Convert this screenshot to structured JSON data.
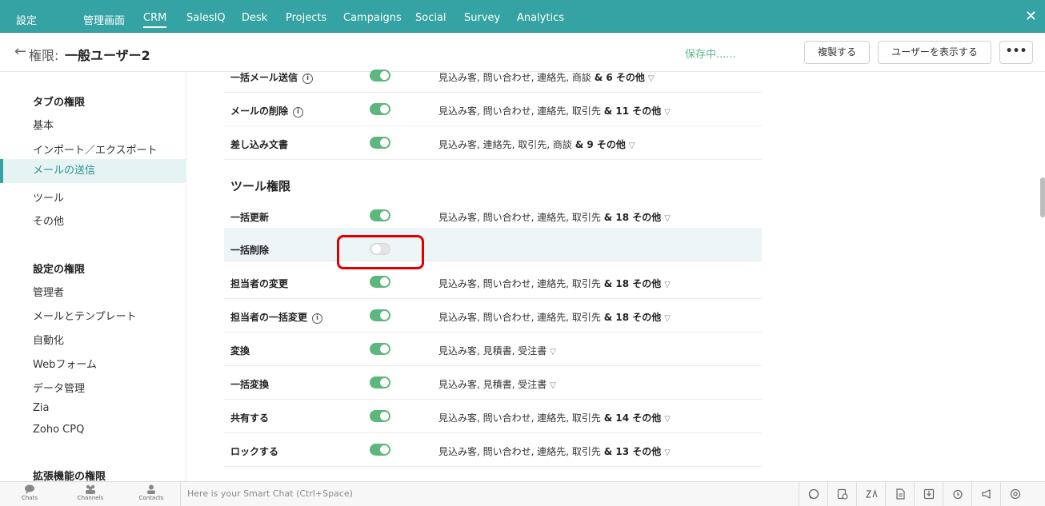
{
  "topbar": {
    "app_label": "設定",
    "nav": [
      "管理画面",
      "CRM",
      "SalesIQ",
      "Desk",
      "Projects",
      "Campaigns",
      "Social",
      "Survey",
      "Analytics"
    ],
    "active_nav": "CRM",
    "close_symbol": "✕"
  },
  "header": {
    "back_symbol": "←",
    "title_prefix": "権限:",
    "title_name": "一般ユーザー2",
    "saving_status": "保存中......",
    "copy_label": "複製する",
    "show_users_label": "ユーザーを表示する",
    "more_label": "•••"
  },
  "sidebar": {
    "tab_permissions_heading": "タブの権限",
    "tab_items": [
      "基本",
      "インポート／エクスポート",
      "メールの送信",
      "ツール",
      "その他"
    ],
    "active_item": "メールの送信",
    "settings_permissions_heading": "設定の権限",
    "settings_items": [
      "管理者",
      "メールとテンプレート",
      "自動化",
      "Webフォーム",
      "データ管理",
      "Zia",
      "Zoho CPQ"
    ],
    "extension_permissions_heading": "拡張機能の権限"
  },
  "main": {
    "email_rows": [
      {
        "label": "一括メール送信",
        "info": true,
        "enabled": true,
        "modules": "見込み客, 問い合わせ, 連絡先, 商談",
        "more": "& 6 その他"
      },
      {
        "label": "メールの削除",
        "info": true,
        "enabled": true,
        "modules": "見込み客, 問い合わせ, 連絡先, 取引先",
        "more": "& 11 その他"
      },
      {
        "label": "差し込み文書",
        "info": false,
        "enabled": true,
        "modules": "見込み客, 連絡先, 取引先, 商談",
        "more": "& 9 その他"
      }
    ],
    "tools_heading": "ツール権限",
    "tool_rows": [
      {
        "label": "一括更新",
        "info": false,
        "enabled": true,
        "modules": "見込み客, 問い合わせ, 連絡先, 取引先",
        "more": "& 18 その他"
      },
      {
        "label": "一括削除",
        "info": false,
        "enabled": false,
        "modules": "",
        "more": ""
      },
      {
        "label": "担当者の変更",
        "info": false,
        "enabled": true,
        "modules": "見込み客, 問い合わせ, 連絡先, 取引先",
        "more": "& 18 その他"
      },
      {
        "label": "担当者の一括変更",
        "info": true,
        "enabled": true,
        "modules": "見込み客, 問い合わせ, 連絡先, 取引先",
        "more": "& 18 その他"
      },
      {
        "label": "変換",
        "info": false,
        "enabled": true,
        "modules": "見込み客, 見積書, 受注書",
        "more": ""
      },
      {
        "label": "一括変換",
        "info": false,
        "enabled": true,
        "modules": "見込み客, 見積書, 受注書",
        "more": ""
      },
      {
        "label": "共有する",
        "info": false,
        "enabled": true,
        "modules": "見込み客, 問い合わせ, 連絡先, 取引先",
        "more": "& 14 その他"
      },
      {
        "label": "ロックする",
        "info": false,
        "enabled": true,
        "modules": "見込み客, 問い合わせ, 連絡先, 取引先",
        "more": "& 13 その他"
      }
    ]
  },
  "bottombar": {
    "items": [
      "Chats",
      "Channels",
      "Contacts"
    ],
    "smart_chat_placeholder": "Here is your Smart Chat (Ctrl+Space)",
    "right_icons": [
      "whatsapp-icon",
      "record-icon",
      "zia-icon",
      "document-icon",
      "download-icon",
      "alarm-icon",
      "announcement-icon",
      "settings-icon"
    ]
  },
  "colors": {
    "accent": "#35a3a3",
    "toggle_on": "#5cb77d",
    "highlight_box": "#e00000",
    "saving_text": "#58b88a"
  }
}
